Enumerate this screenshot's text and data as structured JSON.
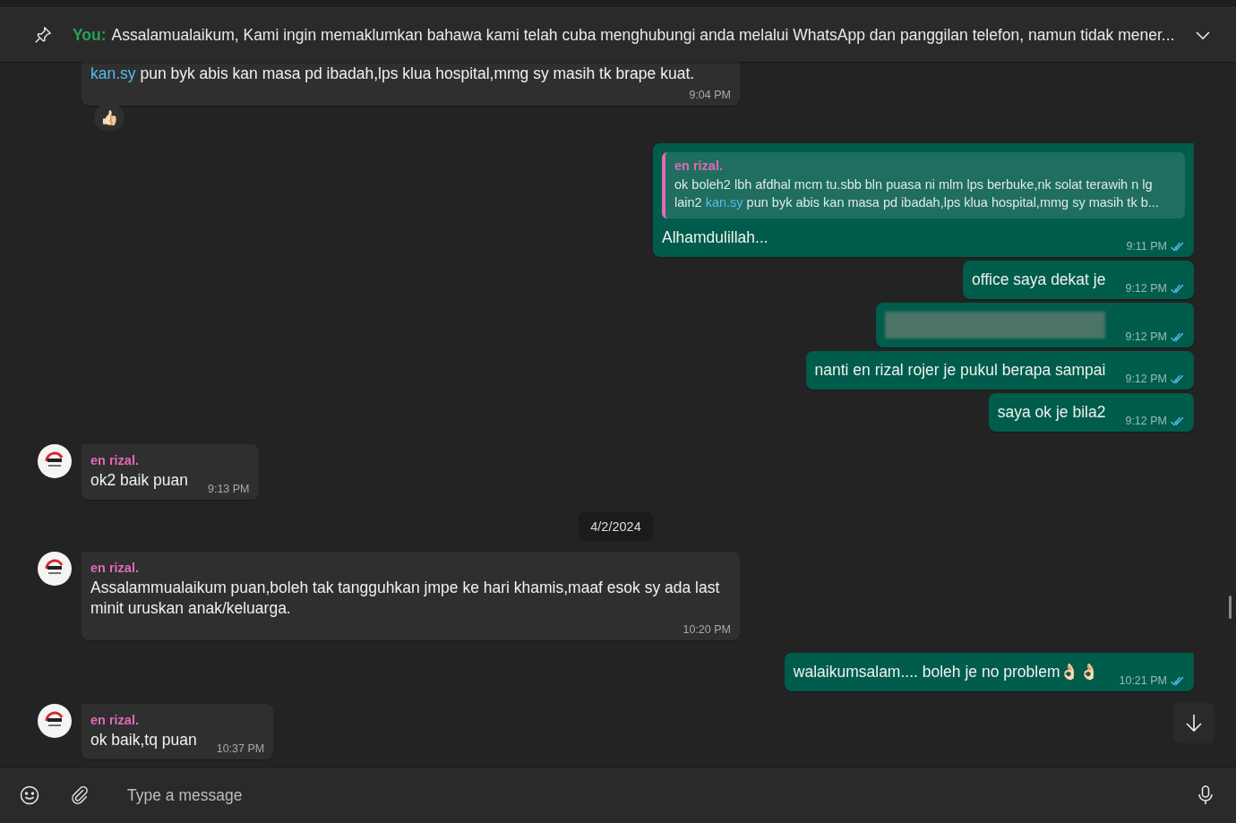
{
  "pinned": {
    "prefix": "You:",
    "text": "Assalamualaikum,  Kami ingin memaklumkan bahawa kami telah cuba menghubungi anda melalui WhatsApp dan panggilan telefon, namun tidak mener..."
  },
  "messages": [
    {
      "kind": "incoming",
      "avatar": false,
      "parts": [
        {
          "kind": "link",
          "text": "kan.sy"
        },
        {
          "kind": "plain",
          "text": " pun byk abis kan masa pd ibadah,lps klua hospital,mmg sy masih tk brape kuat."
        }
      ],
      "time": "9:04 PM",
      "reaction": "👍🏻"
    },
    {
      "kind": "outgoing",
      "tail": true,
      "read": true,
      "quote": {
        "sender": "en rizal.",
        "parts": [
          {
            "kind": "plain",
            "text": "ok boleh2 lbh afdhal mcm tu.sbb bln puasa ni mlm lps berbuke,nk solat terawih n lg lain2 "
          },
          {
            "kind": "link",
            "text": "kan.sy"
          },
          {
            "kind": "plain",
            "text": " pun byk abis kan masa pd ibadah,lps klua hospital,mmg sy masih tk b..."
          }
        ]
      },
      "parts": [
        {
          "kind": "plain",
          "text": "Alhamdulillah..."
        }
      ],
      "time": "9:11 PM"
    },
    {
      "kind": "outgoing",
      "tail": false,
      "read": true,
      "parts": [
        {
          "kind": "plain",
          "text": "office saya dekat je"
        }
      ],
      "time": "9:12 PM"
    },
    {
      "kind": "outgoing",
      "tail": false,
      "read": true,
      "redacted": true,
      "time": "9:12 PM"
    },
    {
      "kind": "outgoing",
      "tail": false,
      "read": true,
      "parts": [
        {
          "kind": "plain",
          "text": "nanti en rizal rojer je pukul berapa sampai"
        }
      ],
      "time": "9:12 PM"
    },
    {
      "kind": "outgoing",
      "tail": false,
      "read": true,
      "parts": [
        {
          "kind": "plain",
          "text": "saya ok je bila2"
        }
      ],
      "time": "9:12 PM"
    },
    {
      "kind": "incoming",
      "tail": true,
      "avatar": true,
      "sender": "en rizal.",
      "parts": [
        {
          "kind": "plain",
          "text": "ok2 baik puan"
        }
      ],
      "time": "9:13 PM"
    },
    {
      "kind": "date",
      "text": "4/2/2024"
    },
    {
      "kind": "incoming",
      "tail": true,
      "avatar": true,
      "sender": "en rizal.",
      "parts": [
        {
          "kind": "plain",
          "text": "Assalammualaikum puan,boleh tak tangguhkan jmpe ke hari khamis,maaf esok sy ada last minit uruskan anak/keluarga."
        }
      ],
      "time": "10:20 PM"
    },
    {
      "kind": "outgoing",
      "tail": true,
      "read": true,
      "parts": [
        {
          "kind": "plain",
          "text": "walaikumsalam.... boleh je no problem👌🏻👌🏻"
        }
      ],
      "time": "10:21 PM"
    },
    {
      "kind": "incoming",
      "tail": true,
      "avatar": true,
      "sender": "en rizal.",
      "parts": [
        {
          "kind": "plain",
          "text": "ok baik,tq puan"
        }
      ],
      "time": "10:37 PM"
    }
  ],
  "composer": {
    "placeholder": "Type a message"
  }
}
